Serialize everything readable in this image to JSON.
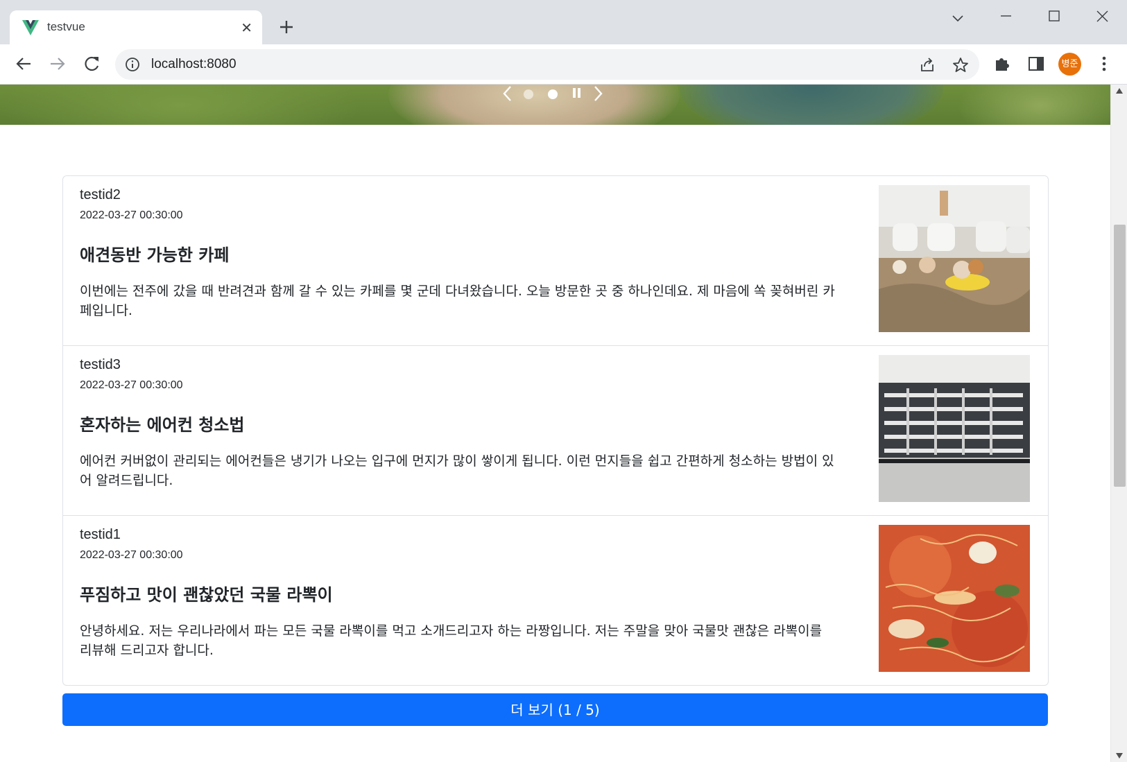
{
  "browser": {
    "tab_title": "testvue",
    "url": "localhost:8080",
    "profile_initials": "병준"
  },
  "carousel": {
    "total_slides": 2,
    "active_slide": 2,
    "icons": [
      "chevron-left-icon",
      "pause-icon",
      "chevron-right-icon"
    ]
  },
  "posts": [
    {
      "user": "testid2",
      "date": "2022-03-27 00:30:00",
      "title": "애견동반 가능한 카페",
      "body": "이번에는 전주에 갔을 때 반려견과 함께 갈 수 있는 카페를 몇 군데 다녀왔습니다. 오늘 방문한 곳 중 하나인데요. 제 마음에 쏙 꽂혀버린 카페입니다."
    },
    {
      "user": "testid3",
      "date": "2022-03-27 00:30:00",
      "title": "혼자하는 에어컨 청소법",
      "body": "에어컨 커버없이 관리되는 에어컨들은 냉기가 나오는 입구에 먼지가 많이 쌓이게 됩니다. 이런 먼지들을 쉽고 간편하게 청소하는 방법이 있어 알려드립니다."
    },
    {
      "user": "testid1",
      "date": "2022-03-27 00:30:00",
      "title": "푸짐하고 맛이 괜찮았던 국물 라뽁이",
      "body": "안녕하세요. 저는 우리나라에서 파는 모든 국물 라뽁이를 먹고 소개드리고자 하는 라짱입니다. 저는 주말을 맞아 국물맛 괜찮은 라뽁이를 리뷰해 드리고자 합니다."
    }
  ],
  "load_more": {
    "label": "더 보기 (1 / 5)"
  },
  "colors": {
    "primary": "#0d6efd",
    "profile": "#e8710a",
    "tabbar": "#dee1e6"
  }
}
